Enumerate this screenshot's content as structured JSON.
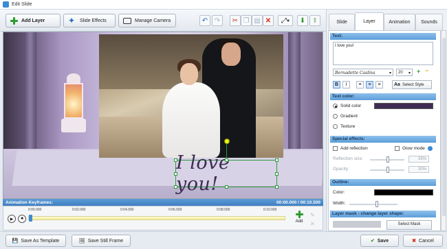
{
  "window": {
    "title": "Edit Slide"
  },
  "toolbar": {
    "add_layer": "Add Layer",
    "slide_effects": "Slide Effects",
    "manage_camera": "Manage Camera"
  },
  "canvas": {
    "text_layer": "I love you!"
  },
  "keyframes": {
    "label": "Animation Keyframes:",
    "time": "00:00.000 / 00:10.500",
    "ticks": [
      "0:00.000",
      "0:02.000",
      "0:04.000",
      "0:06.000",
      "0:08.000",
      "0:10.000"
    ],
    "add_label": "Add"
  },
  "bottom": {
    "save_template": "Save As Template",
    "save_still": "Save Still Frame",
    "save": "Save",
    "cancel": "Cancel"
  },
  "panel": {
    "tabs": [
      "Slide",
      "Layer",
      "Animation",
      "Sounds"
    ],
    "active_tab": "Layer",
    "text_header": "Text:",
    "text_value": "I love you!",
    "font": "Bernadette Caslina",
    "font_size": "20",
    "select_style": "Select Style",
    "text_color_header": "Text color:",
    "solid_color": "Solid color",
    "gradient": "Gradient",
    "texture": "Texture",
    "solid_color_value": "#3f2b55",
    "special_header": "Special effects:",
    "add_reflection": "Add reflection",
    "glow_mode": "Glow mode",
    "reflection_size": "Reflection size:",
    "reflection_size_value": "35%",
    "opacity": "Opacity:",
    "opacity_value": "30%",
    "outline_header": "Outline:",
    "color": "Color:",
    "width": "Width:",
    "outline_color_value": "#000000",
    "mask_header": "Layer mask - change layer shape:",
    "select_mask": "Select Mask"
  }
}
